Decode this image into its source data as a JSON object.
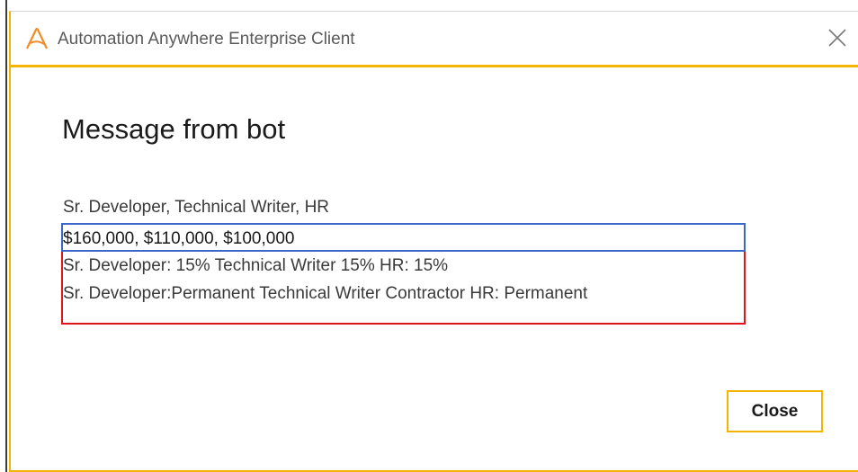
{
  "window": {
    "title": "Automation Anywhere Enterprise Client",
    "logo_icon": "automation-anywhere-logo",
    "close_icon": "close-icon"
  },
  "message": {
    "heading": "Message from bot",
    "lines": [
      "Sr. Developer, Technical Writer, HR",
      "$160,000, $110,000, $100,000",
      "Sr. Developer: 15% Technical Writer 15% HR: 15%",
      "Sr. Developer:Permanent Technical Writer Contractor HR: Permanent"
    ]
  },
  "buttons": {
    "close_label": "Close"
  },
  "colors": {
    "accent": "#f5b400",
    "highlight_blue": "#3a67c9",
    "highlight_red": "#e0141b"
  }
}
